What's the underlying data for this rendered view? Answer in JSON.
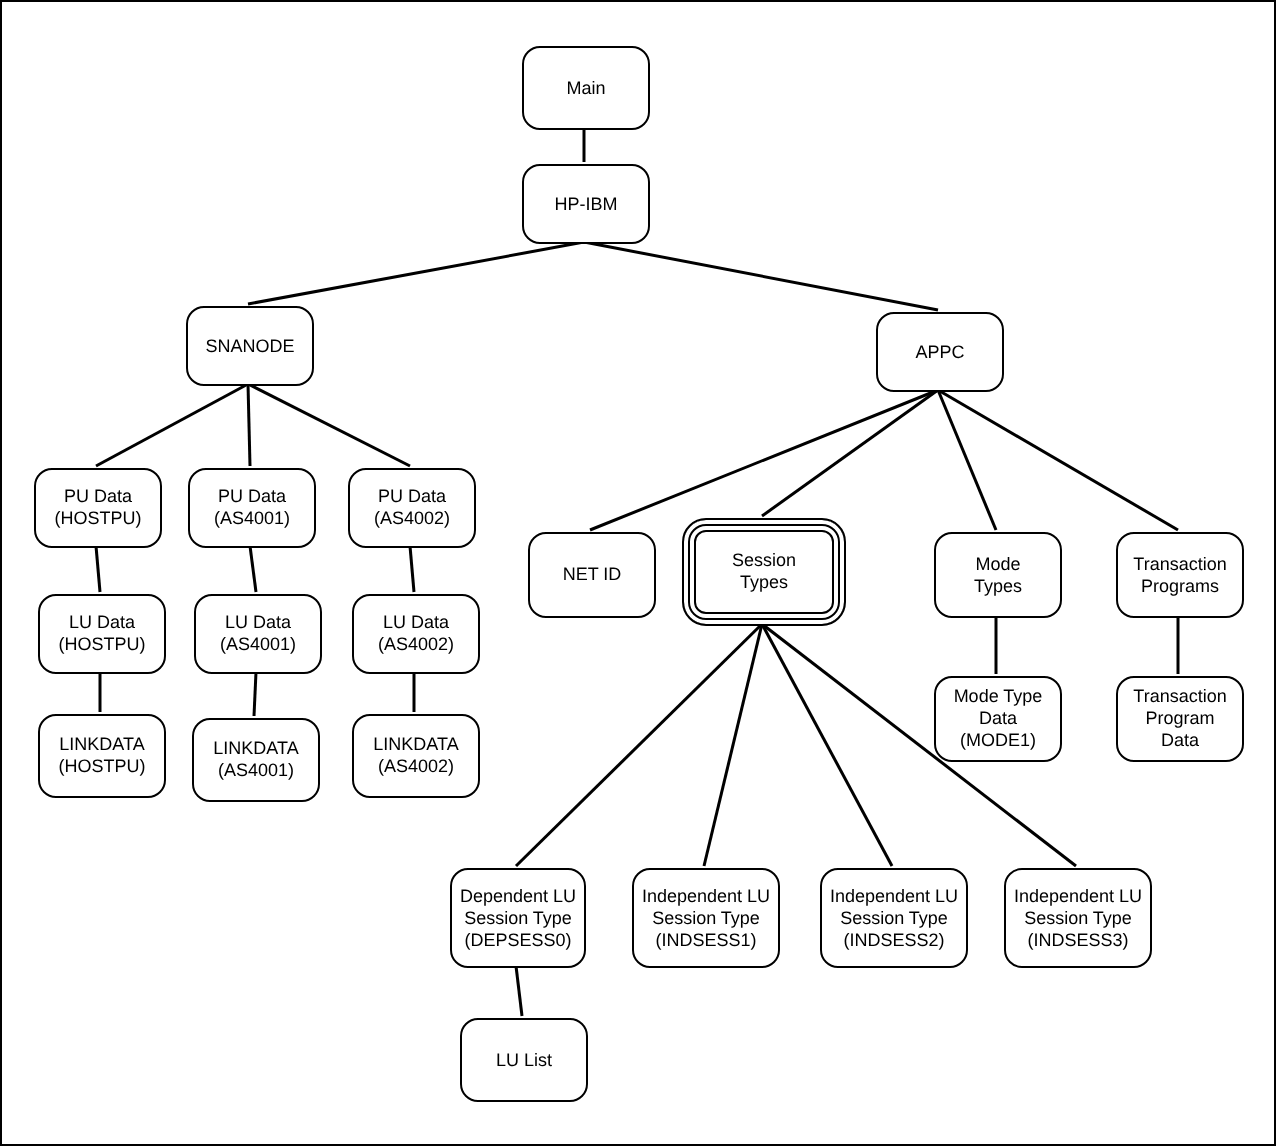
{
  "diagram": {
    "root": {
      "lines": [
        "Main"
      ],
      "selected": false,
      "children": [
        {
          "lines": [
            "HP-IBM"
          ],
          "selected": false,
          "children": [
            {
              "lines": [
                "SNANODE"
              ],
              "selected": false,
              "children": [
                {
                  "lines": [
                    "PU Data",
                    "(HOSTPU)"
                  ],
                  "selected": false,
                  "children": [
                    {
                      "lines": [
                        "LU Data",
                        "(HOSTPU)"
                      ],
                      "selected": false,
                      "children": [
                        {
                          "lines": [
                            "LINKDATA",
                            "(HOSTPU)"
                          ],
                          "selected": false
                        }
                      ]
                    }
                  ]
                },
                {
                  "lines": [
                    "PU Data",
                    "(AS4001)"
                  ],
                  "selected": false,
                  "children": [
                    {
                      "lines": [
                        "LU Data",
                        "(AS4001)"
                      ],
                      "selected": false,
                      "children": [
                        {
                          "lines": [
                            "LINKDATA",
                            "(AS4001)"
                          ],
                          "selected": false
                        }
                      ]
                    }
                  ]
                },
                {
                  "lines": [
                    "PU Data",
                    "(AS4002)"
                  ],
                  "selected": false,
                  "children": [
                    {
                      "lines": [
                        "LU Data",
                        "(AS4002)"
                      ],
                      "selected": false,
                      "children": [
                        {
                          "lines": [
                            "LINKDATA",
                            "(AS4002)"
                          ],
                          "selected": false
                        }
                      ]
                    }
                  ]
                }
              ]
            },
            {
              "lines": [
                "APPC"
              ],
              "selected": false,
              "children": [
                {
                  "lines": [
                    "NET ID"
                  ],
                  "selected": false
                },
                {
                  "lines": [
                    "Session",
                    "Types"
                  ],
                  "selected": true,
                  "children": [
                    {
                      "lines": [
                        "Dependent LU",
                        "Session Type",
                        "(DEPSESS0)"
                      ],
                      "selected": false,
                      "children": [
                        {
                          "lines": [
                            "LU List"
                          ],
                          "selected": false
                        }
                      ]
                    },
                    {
                      "lines": [
                        "Independent LU",
                        "Session Type",
                        "(INDSESS1)"
                      ],
                      "selected": false
                    },
                    {
                      "lines": [
                        "Independent LU",
                        "Session Type",
                        "(INDSESS2)"
                      ],
                      "selected": false
                    },
                    {
                      "lines": [
                        "Independent LU",
                        "Session Type",
                        "(INDSESS3)"
                      ],
                      "selected": false
                    }
                  ]
                },
                {
                  "lines": [
                    "Mode",
                    "Types"
                  ],
                  "selected": false,
                  "children": [
                    {
                      "lines": [
                        "Mode Type",
                        "Data",
                        "(MODE1)"
                      ],
                      "selected": false
                    }
                  ]
                },
                {
                  "lines": [
                    "Transaction",
                    "Programs"
                  ],
                  "selected": false,
                  "children": [
                    {
                      "lines": [
                        "Transaction",
                        "Program",
                        "Data"
                      ],
                      "selected": false
                    }
                  ]
                }
              ]
            }
          ]
        }
      ]
    }
  }
}
